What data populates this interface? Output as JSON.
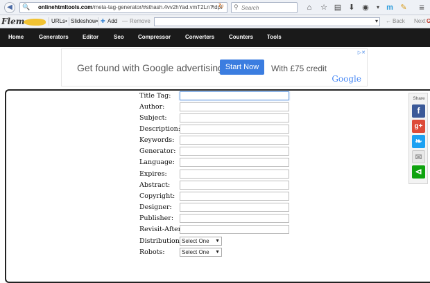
{
  "browser": {
    "url_prefix": "onlinehtmltools.com",
    "url_rest": "/meta-tag-generator/#sthash.4vv2hYad.vmT2Ln7.dpt",
    "search_placeholder": "Search",
    "bookmarks": {
      "urls": "URLs•",
      "slideshow": "Slideshow•",
      "add": "Add",
      "remove": "Remove",
      "back": "Back",
      "next": "Next"
    }
  },
  "site_nav": [
    "Home",
    "Generators",
    "Editor",
    "Seo",
    "Compressor",
    "Converters",
    "Counters",
    "Tools"
  ],
  "ad": {
    "headline": "Get found with Google advertising.",
    "button": "Start Now",
    "offer": "With £75 credit",
    "brand": "Google"
  },
  "form": {
    "fields": [
      "Title Tag:",
      "Author:",
      "Subject:",
      "Description:",
      "Keywords:",
      "Generator:",
      "Language:",
      "Expires:",
      "Abstract:",
      "Copyright:",
      "Designer:",
      "Publisher:",
      "Revisit-After:"
    ],
    "selects": [
      {
        "label": "Distribution:",
        "value": "Select One"
      },
      {
        "label": "Robots:",
        "value": "Select One"
      }
    ]
  },
  "share": {
    "label": "Share",
    "buttons": [
      {
        "name": "facebook",
        "color": "#3b5998"
      },
      {
        "name": "google-plus",
        "color": "#dd4b39"
      },
      {
        "name": "twitter",
        "color": "#1da1f2"
      },
      {
        "name": "email",
        "color": "#e8e8e8"
      },
      {
        "name": "sharethis",
        "color": "#0fa30f"
      }
    ]
  }
}
